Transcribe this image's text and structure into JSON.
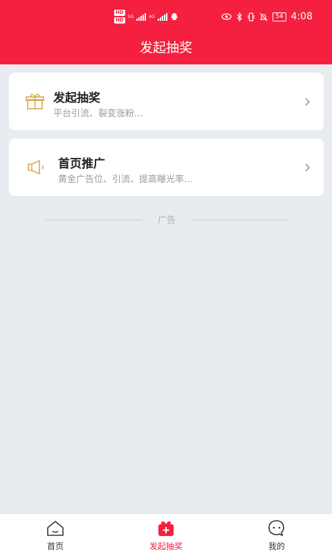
{
  "status_bar": {
    "network_labels": [
      "HD",
      "HD"
    ],
    "network_types": [
      "5G",
      "4G"
    ],
    "battery": "54",
    "time": "4:08"
  },
  "header": {
    "title": "发起抽奖"
  },
  "cards": [
    {
      "icon": "gift-icon",
      "title": "发起抽奖",
      "subtitle": "平台引流、裂变涨粉…"
    },
    {
      "icon": "megaphone-icon",
      "title": "首页推广",
      "subtitle": "黄金广告位、引流、提高曝光率…"
    }
  ],
  "ad_label": "广告",
  "tabbar": {
    "items": [
      {
        "label": "首页",
        "icon": "home-icon",
        "active": false
      },
      {
        "label": "发起抽奖",
        "icon": "gift-plus-icon",
        "active": true
      },
      {
        "label": "我的",
        "icon": "chat-face-icon",
        "active": false
      }
    ]
  },
  "colors": {
    "brand_red": "#f5203f",
    "background": "#e8ebef",
    "icon_gold": "#d4a94e"
  }
}
